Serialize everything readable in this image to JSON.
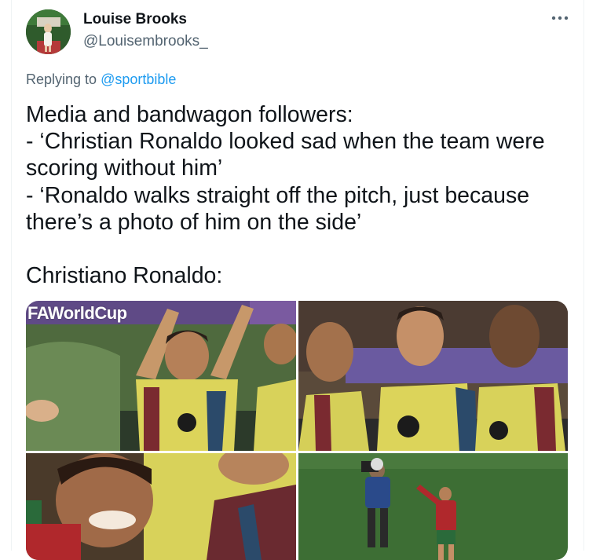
{
  "tweet": {
    "author": {
      "name": "Louise Brooks",
      "handle": "@Louisembrooks_"
    },
    "more_icon": "ellipsis-icon",
    "reply": {
      "prefix": "Replying to ",
      "handle": "@sportbible"
    },
    "text_lines": [
      "Media and bandwagon followers:",
      "- ‘Christian Ronaldo looked sad when the team were",
      "scoring without him’",
      "- ‘Ronaldo walks straight off the pitch, just because",
      "there’s a photo of him on the side’",
      "Christiano Ronaldo:"
    ],
    "media": {
      "photo_1_watermark": "FAWorldCup"
    }
  },
  "colors": {
    "link": "#1d9bf0",
    "secondary_text": "#536471",
    "primary_text": "#0f1419",
    "border": "#eff3f4"
  }
}
